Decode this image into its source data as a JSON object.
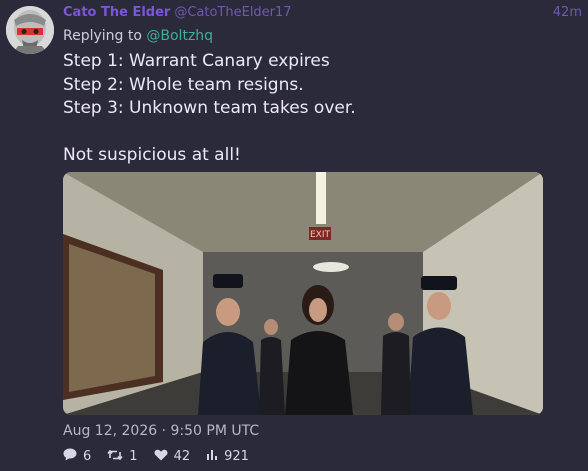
{
  "tweet": {
    "author_name": "Cato The Elder",
    "author_handle": "@CatoTheElder17",
    "time_ago": "42m",
    "replying_prefix": "Replying to",
    "replying_to": "@Boltzhq",
    "lines": [
      "Step 1: Warrant Canary expires",
      "Step 2: Whole team resigns.",
      "Step 3: Unknown team takes over.",
      "",
      "Not suspicious at all!"
    ],
    "media_sign": "EXIT",
    "timestamp": "Aug 12, 2026 · 9:50 PM UTC",
    "stats": {
      "replies": "6",
      "retweets": "1",
      "likes": "42",
      "views": "921"
    }
  },
  "colors": {
    "background": "#2b2a3a",
    "author_name": "#7b56d6",
    "handle": "#6e5ab0",
    "reply_link": "#3fae9a",
    "text": "#ece9f5"
  },
  "icons": [
    "avatar-image",
    "reply-icon",
    "retweet-icon",
    "like-icon",
    "views-icon"
  ]
}
